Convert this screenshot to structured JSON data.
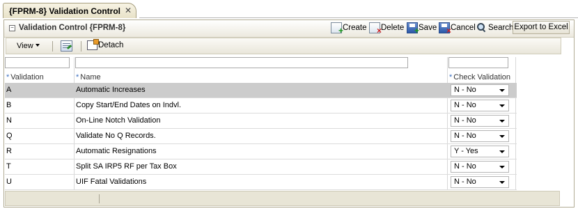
{
  "tab": {
    "title": "{FPRM-8} Validation Control",
    "close": "✕"
  },
  "panel": {
    "collapse": "−",
    "title": "Validation Control {FPRM-8}",
    "actions": {
      "create": "Create",
      "delete": "Delete",
      "save": "Save",
      "cancel": "Cancel",
      "search": "Search",
      "export": "Export to Excel"
    }
  },
  "toolbar": {
    "view": "View",
    "detach": "Detach"
  },
  "table": {
    "required_marker": "*",
    "columns": [
      "Validation",
      "Name",
      "Check Validation"
    ],
    "rows": [
      {
        "code": "A",
        "name": "Automatic Increases",
        "check": "N - No",
        "selected": true
      },
      {
        "code": "B",
        "name": "Copy Start/End Dates on Indvl.",
        "check": "N - No"
      },
      {
        "code": "N",
        "name": "On-Line Notch Validation",
        "check": "N - No"
      },
      {
        "code": "Q",
        "name": "Validate No Q Records.",
        "check": "N - No"
      },
      {
        "code": "R",
        "name": "Automatic Resignations",
        "check": "Y - Yes"
      },
      {
        "code": "T",
        "name": "Split SA IRP5 RF per Tax Box",
        "check": "N - No"
      },
      {
        "code": "U",
        "name": "UIF Fatal Validations",
        "check": "N - No"
      }
    ]
  },
  "colors": {
    "selected_row": "#cccccc",
    "required_marker": "#3a6fc0"
  }
}
